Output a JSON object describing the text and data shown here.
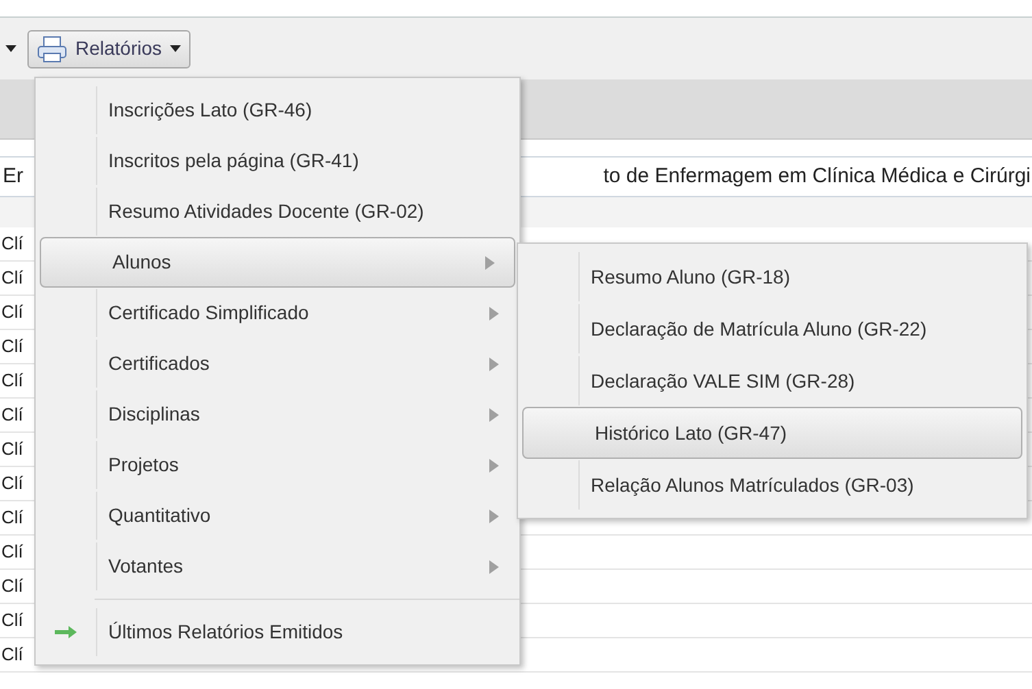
{
  "toolbar": {
    "report_button": {
      "label": "Relatórios"
    }
  },
  "form": {
    "field_start": "Er",
    "field_end": "to de Enfermagem em Clínica Médica e Cirúrgi"
  },
  "table": {
    "rows": [
      {
        "cell": "Clí"
      },
      {
        "cell": "Clí"
      },
      {
        "cell": "Clí"
      },
      {
        "cell": "Clí"
      },
      {
        "cell": "Clí"
      },
      {
        "cell": "Clí"
      },
      {
        "cell": "Clí"
      },
      {
        "cell": "Clí"
      },
      {
        "cell": "Clí"
      },
      {
        "cell": "Clí"
      },
      {
        "cell": "Clí"
      },
      {
        "cell": "Clí"
      },
      {
        "cell": "Clí"
      }
    ]
  },
  "menu": {
    "items": [
      {
        "kind": "plain",
        "label": "Inscrições Lato (GR-46)",
        "selected": false
      },
      {
        "kind": "plain",
        "label": "Inscritos pela página (GR-41)",
        "selected": false
      },
      {
        "kind": "plain",
        "label": "Resumo Atividades Docente (GR-02)",
        "selected": false
      },
      {
        "kind": "submenu",
        "label": "Alunos",
        "selected": true
      },
      {
        "kind": "submenu",
        "label": "Certificado Simplificado",
        "selected": false
      },
      {
        "kind": "submenu",
        "label": "Certificados",
        "selected": false
      },
      {
        "kind": "submenu",
        "label": "Disciplinas",
        "selected": false
      },
      {
        "kind": "submenu",
        "label": "Projetos",
        "selected": false
      },
      {
        "kind": "submenu",
        "label": "Quantitativo",
        "selected": false
      },
      {
        "kind": "submenu",
        "label": "Votantes",
        "selected": false
      },
      {
        "kind": "action",
        "label": "Últimos Relatórios Emitidos",
        "selected": false
      }
    ]
  },
  "submenu": {
    "items": [
      {
        "label": "Resumo Aluno (GR-18)",
        "selected": false
      },
      {
        "label": "Declaração de Matrícula Aluno (GR-22)",
        "selected": false
      },
      {
        "label": "Declaração VALE SIM (GR-28)",
        "selected": false
      },
      {
        "label": "Histórico Lato (GR-47)",
        "selected": true
      },
      {
        "label": "Relação Alunos Matrículados (GR-03)",
        "selected": false
      }
    ]
  }
}
